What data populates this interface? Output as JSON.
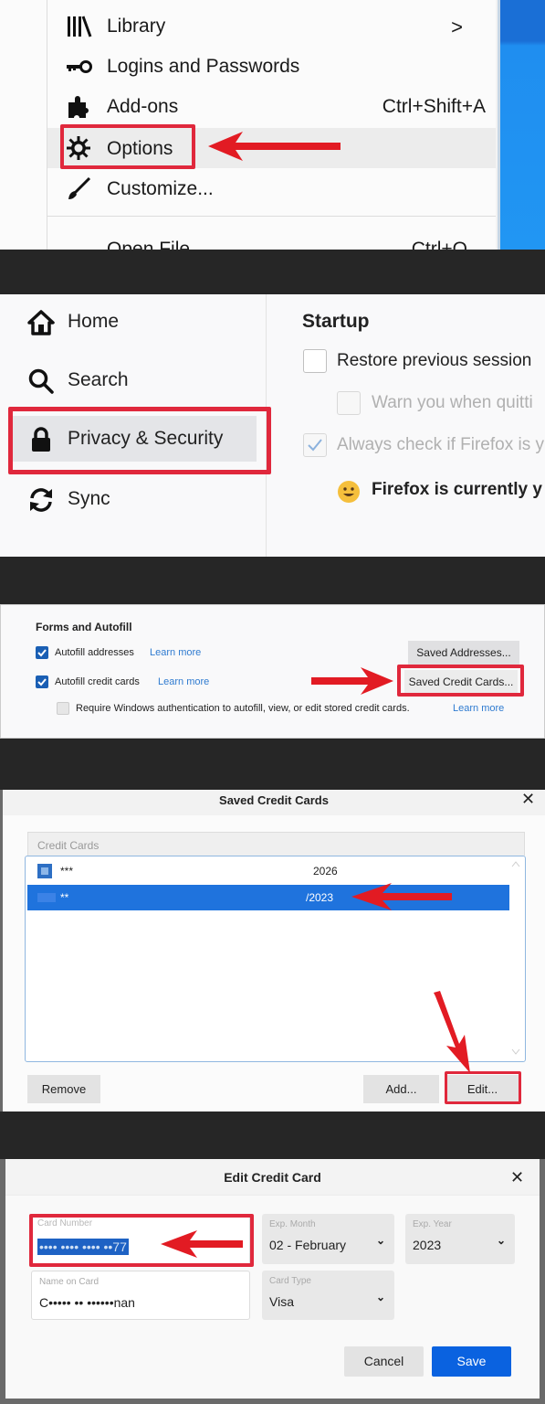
{
  "step1_menu": {
    "items": [
      {
        "label": "Library",
        "icon": "library-icon",
        "shortcut": "",
        "submenu": true
      },
      {
        "label": "Logins and Passwords",
        "icon": "key-icon",
        "shortcut": ""
      },
      {
        "label": "Add-ons",
        "icon": "puzzle-icon",
        "shortcut": "Ctrl+Shift+A"
      },
      {
        "label": "Options",
        "icon": "gear-icon",
        "shortcut": "",
        "highlighted": true
      },
      {
        "label": "Customize...",
        "icon": "brush-icon",
        "shortcut": ""
      },
      {
        "label": "Open File...",
        "icon": "",
        "shortcut": "Ctrl+O"
      }
    ],
    "submenu_glyph": ">"
  },
  "step2_preferences": {
    "sidebar": [
      {
        "label": "Home",
        "icon": "home-icon"
      },
      {
        "label": "Search",
        "icon": "search-icon"
      },
      {
        "label": "Privacy & Security",
        "icon": "lock-icon",
        "selected": true
      },
      {
        "label": "Sync",
        "icon": "sync-icon"
      }
    ],
    "section_title": "Startup",
    "options": [
      {
        "label": "Restore previous session",
        "checked": false,
        "disabled": false
      },
      {
        "label": "Warn you when quitti",
        "checked": false,
        "disabled": true
      },
      {
        "label": "Always check if Firefox is y",
        "checked": true,
        "disabled": true
      }
    ],
    "default_status": "Firefox is currently y"
  },
  "step3_forms": {
    "section_title": "Forms and Autofill",
    "rows": [
      {
        "label": "Autofill addresses",
        "checked": true,
        "link": "Learn more",
        "button": "Saved Addresses..."
      },
      {
        "label": "Autofill credit cards",
        "checked": true,
        "link": "Learn more",
        "button": "Saved Credit Cards..."
      }
    ],
    "require_auth": {
      "label": "Require Windows authentication to autofill, view, or edit stored credit cards.",
      "checked": false,
      "link": "Learn more"
    }
  },
  "step4_saved_cards": {
    "title": "Saved Credit Cards",
    "close_glyph": "✕",
    "list_header": "Credit Cards",
    "cards": [
      {
        "masked_prefix": "***",
        "expiry_suffix": "2026",
        "selected": false
      },
      {
        "masked_prefix": "**",
        "expiry_suffix": "/2023",
        "selected": true
      }
    ],
    "buttons": {
      "remove": "Remove",
      "add": "Add...",
      "edit": "Edit..."
    }
  },
  "step5_edit_card": {
    "title": "Edit Credit Card",
    "close_glyph": "✕",
    "fields": {
      "card_number": {
        "label": "Card Number",
        "value": "•••• •••• •••• ••77"
      },
      "exp_month": {
        "label": "Exp. Month",
        "value": "02 - February"
      },
      "exp_year": {
        "label": "Exp. Year",
        "value": "2023"
      },
      "name_on_card": {
        "label": "Name on Card",
        "value": "C••••• •• ••••••nan"
      },
      "card_type": {
        "label": "Card Type",
        "value": "Visa"
      }
    },
    "buttons": {
      "cancel": "Cancel",
      "save": "Save"
    }
  },
  "colors": {
    "annotation_red": "#e0283c",
    "selection_blue": "#1f73dd",
    "save_blue": "#0a62e0",
    "link_blue": "#2f7bd0"
  }
}
